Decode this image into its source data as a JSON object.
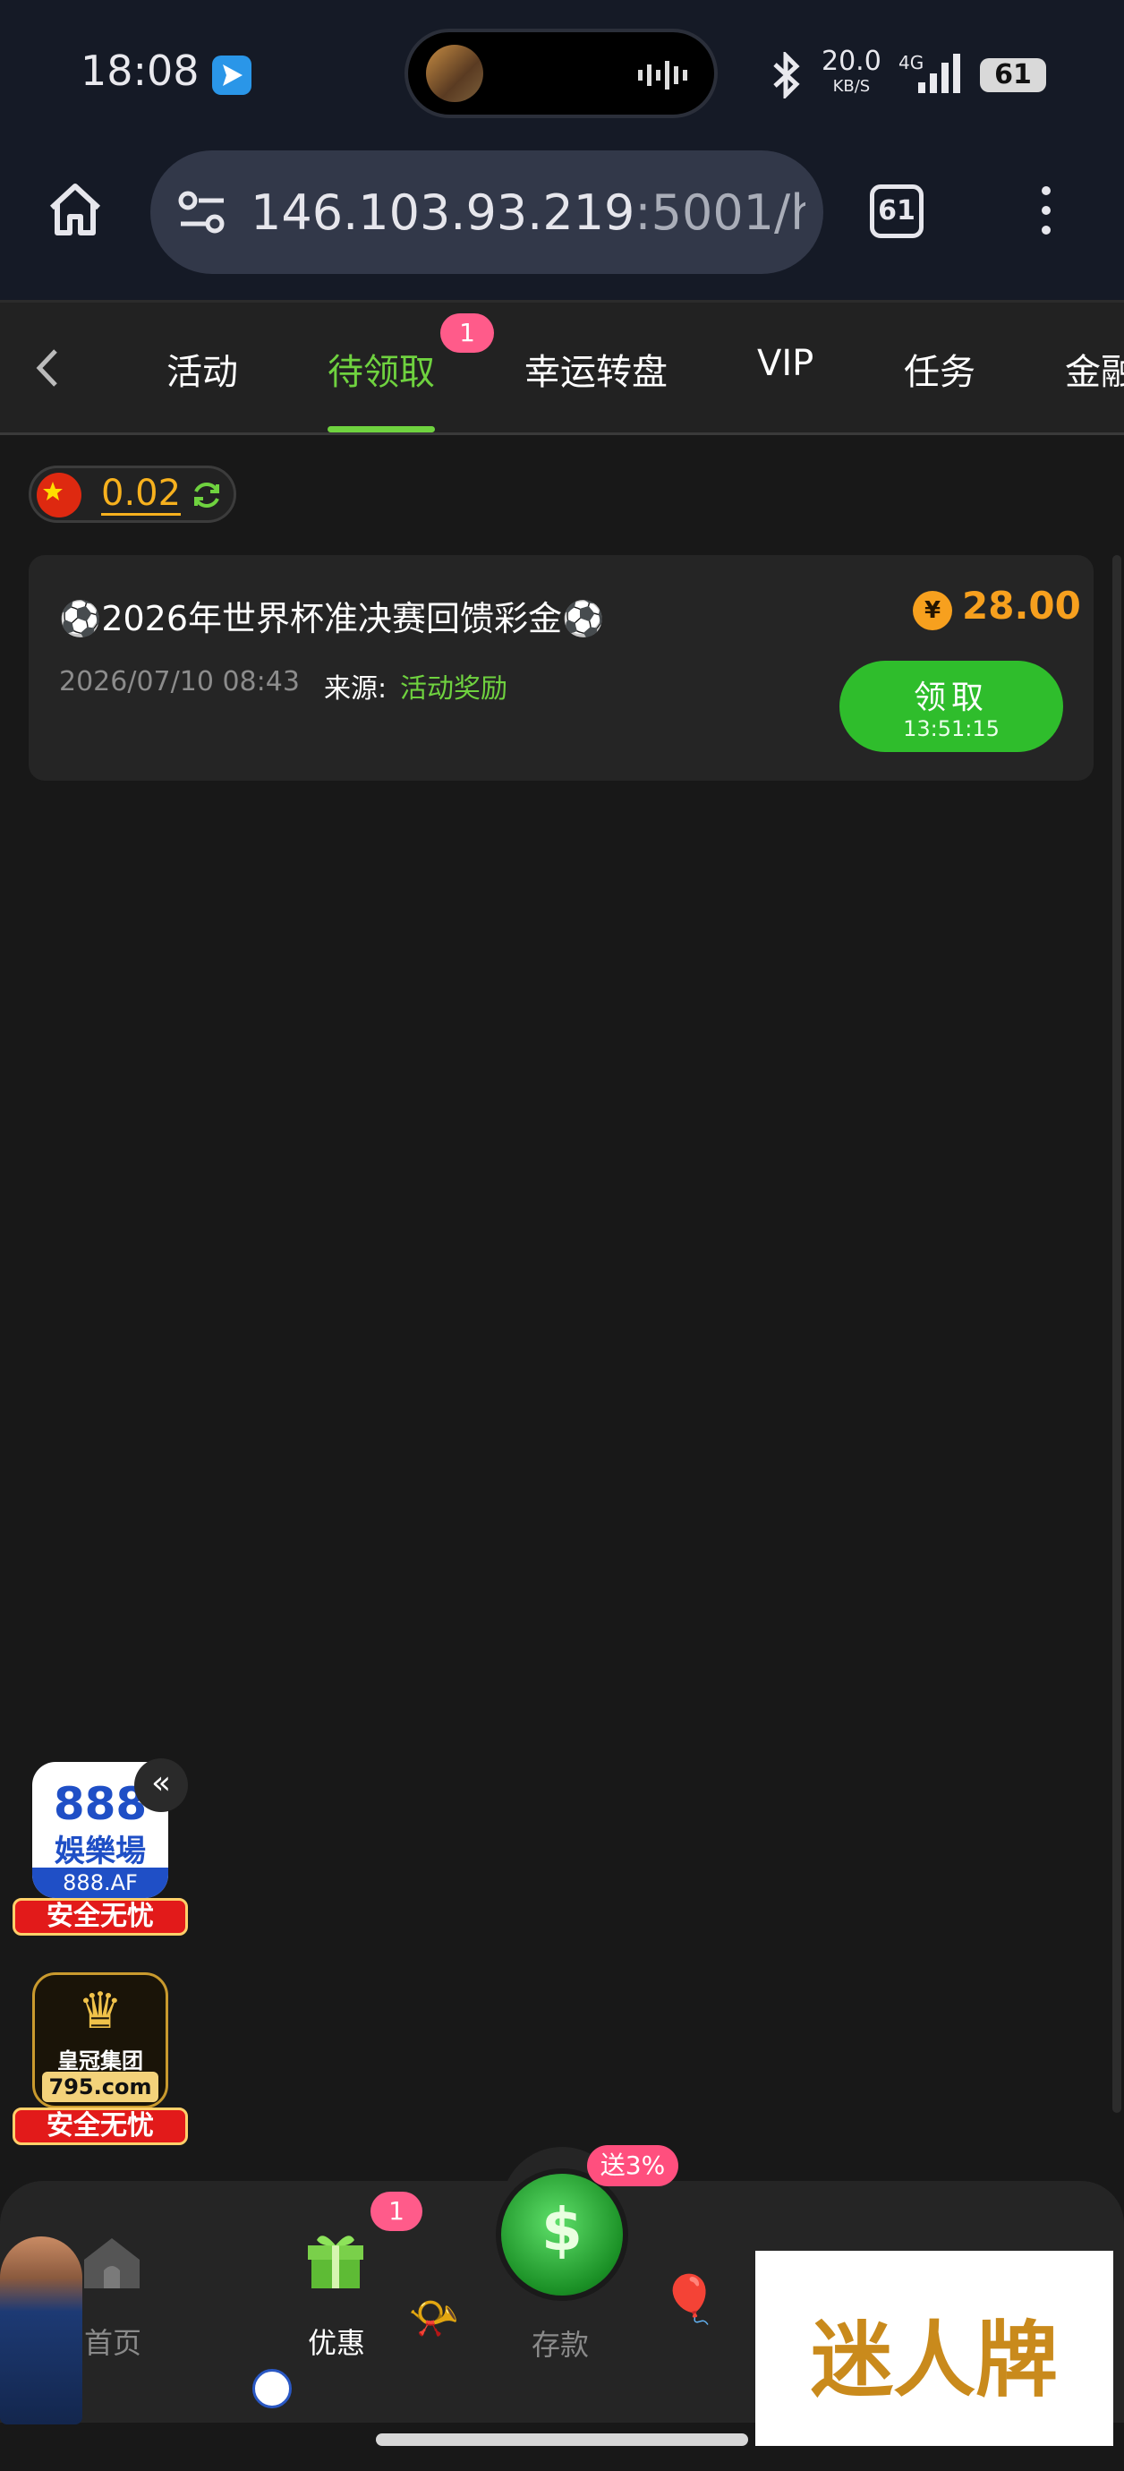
{
  "status_bar": {
    "time": "18:08",
    "speed_value": "20.0",
    "speed_unit": "KB/S",
    "network": "4G",
    "battery": "61"
  },
  "browser": {
    "url_host": "146.103.93.219",
    "url_rest": ":5001/hor",
    "tab_count": "61"
  },
  "nav_tabs": {
    "items": [
      {
        "label": "活动"
      },
      {
        "label": "待领取"
      },
      {
        "label": "幸运转盘"
      },
      {
        "label": "VIP"
      },
      {
        "label": "任务"
      },
      {
        "label": "金融"
      }
    ],
    "badge": "1"
  },
  "balance": {
    "value": "0.02"
  },
  "reward": {
    "title": "⚽2026年世界杯准决赛回馈彩金⚽",
    "currency_symbol": "¥",
    "amount": "28.00",
    "date": "2026/07/10 08:43",
    "source_label": "来源:",
    "source": "活动奖励",
    "claim_label": "领取",
    "claim_timer": "13:51:15"
  },
  "ads": {
    "ad1_top": "888",
    "ad1_mid": "娛樂場",
    "ad1_domain": "888.AF",
    "ad1_ribbon": "安全无忧",
    "collapse": "«",
    "ad2_name": "皇冠集团",
    "ad2_domain": "795.com",
    "ad2_ribbon": "安全无忧"
  },
  "bottom_nav": {
    "home": "首页",
    "promo": "优惠",
    "promo_badge": "1",
    "deposit": "存款",
    "deposit_bonus": "送3%",
    "logo": "迷人牌"
  },
  "colors": {
    "accent_green": "#6fd23f",
    "amount_orange": "#f7a01e",
    "badge_pink": "#ff5b8a",
    "button_green": "#2fbd2c"
  }
}
